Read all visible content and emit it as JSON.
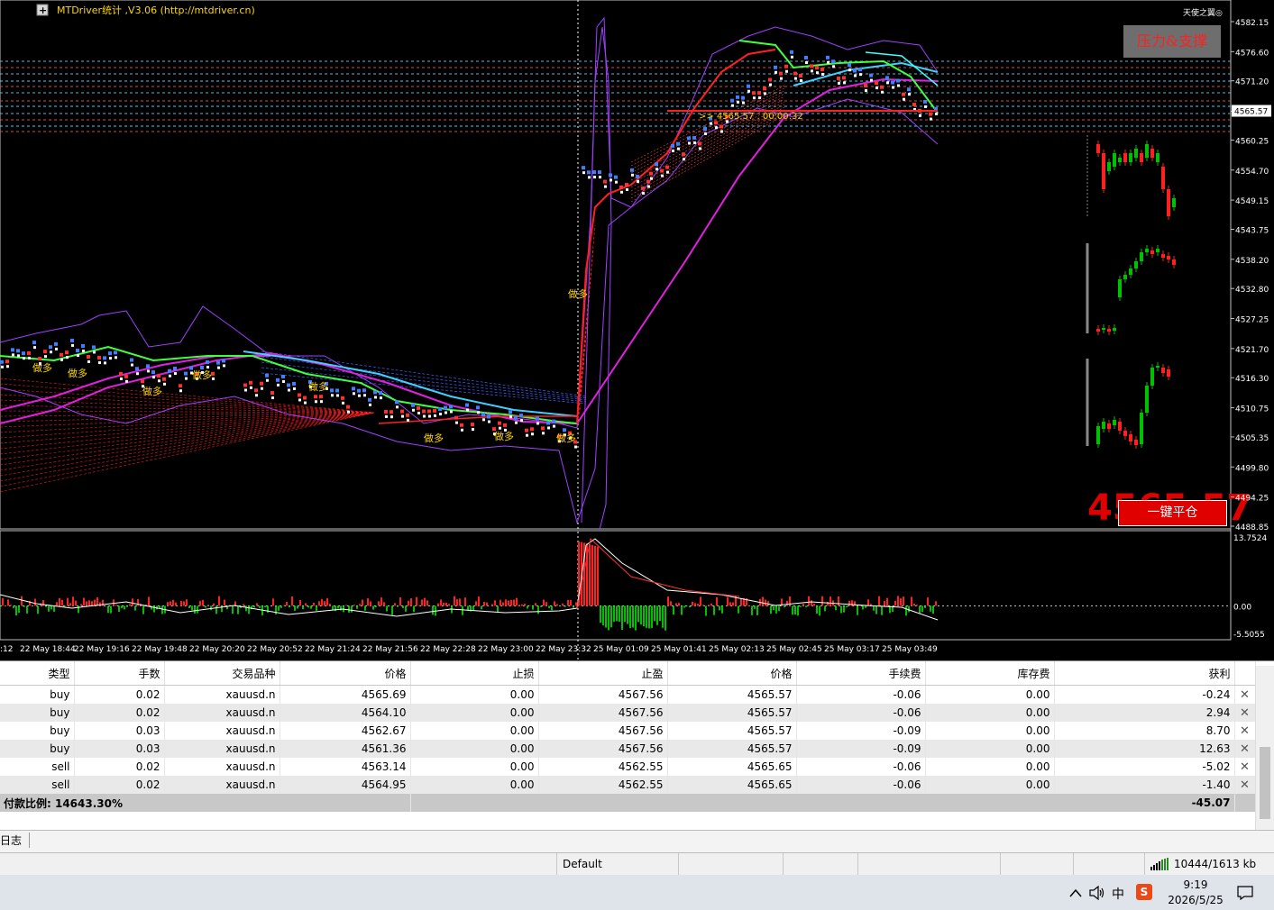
{
  "chart": {
    "title": "MTDriver统计 ,V3.06 (http://mtdriver.cn)",
    "top_right_label": "天使之翼◎",
    "current_price": "4565.57",
    "big_price": "4565.57",
    "price_line_label": ">> 4565.57 . 00:00:32",
    "sr_button": "压力&支撑",
    "close_all_button": "一键平仓",
    "plus_sign": "+",
    "signal_label": "做多",
    "price_ticks": [
      "4582.15",
      "4576.60",
      "4571.20",
      "4565.57",
      "4560.25",
      "4554.70",
      "4549.15",
      "4543.75",
      "4538.20",
      "4532.80",
      "4527.25",
      "4521.70",
      "4516.30",
      "4510.75",
      "4505.35",
      "4499.80",
      "4494.25",
      "4488.85"
    ],
    "osc_ticks": [
      "13.7524",
      "0.00",
      "-5.5055"
    ],
    "time_ticks": [
      ":12",
      "22 May 18:44",
      "22 May 19:16",
      "22 May 19:48",
      "22 May 20:20",
      "22 May 20:52",
      "22 May 21:24",
      "22 May 21:56",
      "22 May 22:28",
      "22 May 23:00",
      "22 May 23:32",
      "25 May 01:09",
      "25 May 01:41",
      "25 May 02:13",
      "25 May 02:45",
      "25 May 03:17",
      "25 May 03:49"
    ],
    "colors": {
      "bg": "#000000",
      "bull": "#00c000",
      "bear": "#ff2020",
      "magenta": "#e020e0",
      "cyan": "#40d0ff",
      "green_ma": "#40ff40",
      "red_ma": "#ff2020",
      "purple": "#a040ff",
      "yellow": "#ffd700"
    }
  },
  "orders": {
    "headers": [
      "类型",
      "手数",
      "交易品种",
      "价格",
      "止损",
      "止盈",
      "价格",
      "手续费",
      "库存费",
      "获利"
    ],
    "rows": [
      [
        "buy",
        "0.02",
        "xauusd.n",
        "4565.69",
        "0.00",
        "4567.56",
        "4565.57",
        "-0.06",
        "0.00",
        "-0.24"
      ],
      [
        "buy",
        "0.02",
        "xauusd.n",
        "4564.10",
        "0.00",
        "4567.56",
        "4565.57",
        "-0.06",
        "0.00",
        "2.94"
      ],
      [
        "buy",
        "0.03",
        "xauusd.n",
        "4562.67",
        "0.00",
        "4567.56",
        "4565.57",
        "-0.09",
        "0.00",
        "8.70"
      ],
      [
        "buy",
        "0.03",
        "xauusd.n",
        "4561.36",
        "0.00",
        "4567.56",
        "4565.57",
        "-0.09",
        "0.00",
        "12.63"
      ],
      [
        "sell",
        "0.02",
        "xauusd.n",
        "4563.14",
        "0.00",
        "4562.55",
        "4565.65",
        "-0.06",
        "0.00",
        "-5.02"
      ],
      [
        "sell",
        "0.02",
        "xauusd.n",
        "4564.95",
        "0.00",
        "4562.55",
        "4565.65",
        "-0.06",
        "0.00",
        "-1.40"
      ]
    ],
    "close_symbol": "✕",
    "summary_label": "付款比例: 14643.30%",
    "summary_profit": "-45.07"
  },
  "tabs": {
    "journal": "日志"
  },
  "statusbar": {
    "profile": "Default",
    "traffic": "10444/1613 kb"
  },
  "taskbar": {
    "ime": "中",
    "sogou": "S",
    "time": "9:19",
    "date": "2026/5/25"
  }
}
